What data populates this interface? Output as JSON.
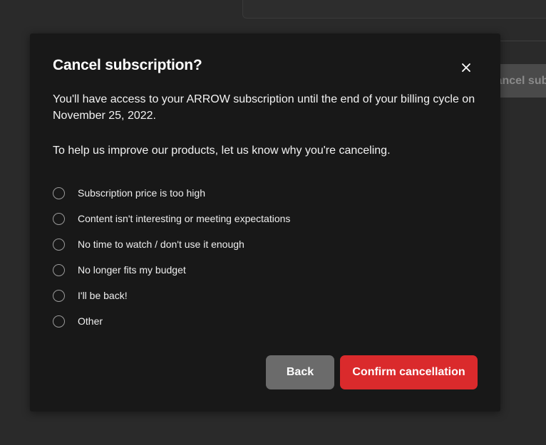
{
  "background": {
    "partial_button_label": "Cancel subscription"
  },
  "modal": {
    "title": "Cancel subscription?",
    "close_icon": "close-icon",
    "description": "You'll have access to your ARROW subscription until the end of your billing cycle on November 25, 2022.",
    "prompt": "To help us improve our products, let us know why you're canceling.",
    "reasons": [
      "Subscription price is too high",
      "Content isn't interesting or meeting expectations",
      "No time to watch / don't use it enough",
      "No longer fits my budget",
      "I'll be back!",
      "Other"
    ],
    "back_label": "Back",
    "confirm_label": "Confirm cancellation"
  },
  "colors": {
    "modal_background": "#181818",
    "page_background": "#2a2a2a",
    "confirm_button": "#da2a2c",
    "back_button": "#6b6b6b"
  }
}
